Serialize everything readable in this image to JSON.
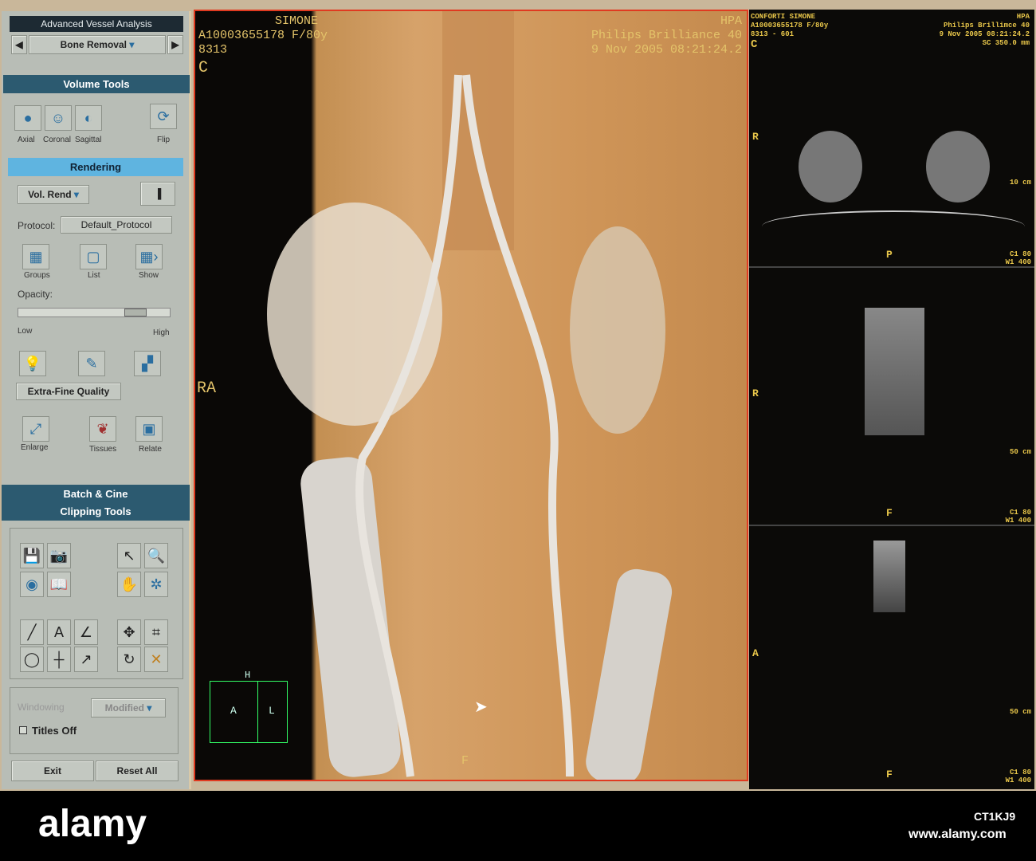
{
  "left_panel": {
    "title": "Advanced Vessel Analysis",
    "mode_select": "Bone Removal",
    "volume_tools": "Volume Tools",
    "views": [
      "Axial",
      "Coronal",
      "Sagittal",
      "Flip"
    ],
    "rendering": "Rendering",
    "render_mode": "Vol. Rend",
    "protocol_label": "Protocol:",
    "protocol_value": "Default_Protocol",
    "render_buttons": [
      "Groups",
      "List",
      "Show"
    ],
    "opacity_label": "Opacity:",
    "opacity_low": "Low",
    "opacity_high": "High",
    "opacity_value": 0.7,
    "quality": "Extra-Fine Quality",
    "tools": [
      "Enlarge",
      "Tissues",
      "Relate"
    ],
    "batch_cine": "Batch & Cine",
    "clipping_tools": "Clipping Tools",
    "windowing_label": "Windowing",
    "windowing_value": "Modified",
    "titles_off": "Titles Off",
    "exit": "Exit",
    "reset_all": "Reset All"
  },
  "main_view": {
    "patient": "SIMONE",
    "id": "A10003655178 F/80y",
    "series": "8313",
    "orientation_top": "C",
    "institution": "HPA",
    "scanner": "Philips Brilliance 40",
    "datetime": "9 Nov 2005 08:21:24.2",
    "side_label": "RA",
    "bottom_label": "F",
    "cube": {
      "top": "H",
      "front": "A",
      "side": "L"
    }
  },
  "right_views": {
    "patient": "CONFORTI SIMONE",
    "id": "A10003655178 F/80y",
    "series": "8313 - 601",
    "orientation": "C",
    "institution": "HPA",
    "scanner": "Philips Brillimce 40",
    "datetime": "9 Nov 2005 08:21:24.2",
    "sc": "SC 350.0 mm",
    "panels": [
      {
        "left": "R",
        "bottom": "P",
        "scale": "10 cm",
        "c": "C1 80",
        "w": "W1 400"
      },
      {
        "left": "R",
        "bottom": "F",
        "scale": "50 cm",
        "c": "C1 80",
        "w": "W1 400"
      },
      {
        "left": "A",
        "bottom": "F",
        "scale": "50 cm",
        "c": "C1 80",
        "w": "W1 400"
      }
    ]
  },
  "watermark": {
    "brand": "alamy",
    "image_id": "CT1KJ9",
    "url": "www.alamy.com"
  }
}
